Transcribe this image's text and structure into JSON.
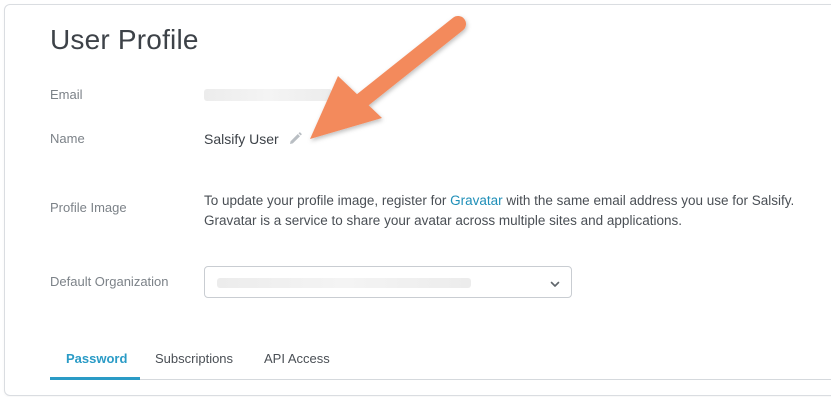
{
  "page": {
    "title": "User Profile"
  },
  "fields": {
    "email_label": "Email",
    "name_label": "Name",
    "name_value": "Salsify User",
    "profile_image_label": "Profile Image",
    "profile_text_before": "To update your profile image, register for ",
    "gravatar_link": "Gravatar",
    "profile_text_after": " with the same email address you use for Salsify. Gravatar is a service to share your avatar across multiple sites and applications.",
    "default_org_label": "Default Organization"
  },
  "tabs": [
    {
      "label": "Password",
      "active": true
    },
    {
      "label": "Subscriptions",
      "active": false
    },
    {
      "label": "API Access",
      "active": false
    }
  ],
  "icons": {
    "edit": "pencil-icon",
    "dropdown": "chevron-down-icon",
    "annotation": "arrow-icon"
  },
  "colors": {
    "accent": "#2a9bc6",
    "link": "#1f8fb8",
    "annotation_arrow": "#f38a5c"
  }
}
